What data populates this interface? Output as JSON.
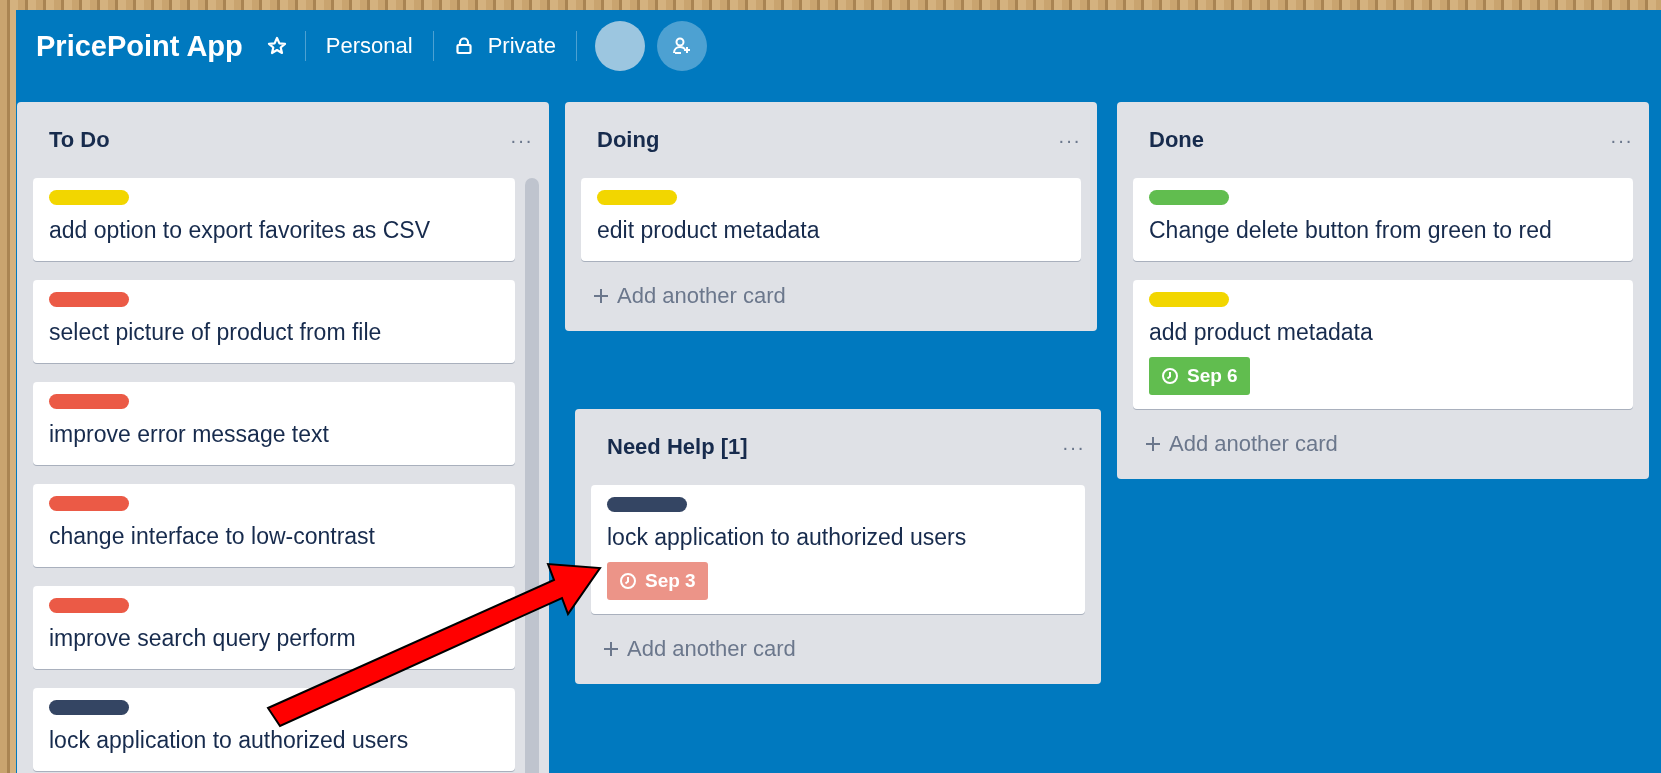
{
  "board": {
    "title": "PricePoint App",
    "starred": false,
    "team": "Personal",
    "visibility": "Private"
  },
  "lists": [
    {
      "title": "To Do",
      "menu": "···",
      "scrollable": true,
      "cards": [
        {
          "label": {
            "color": "#f2d600"
          },
          "text": "add option to export favorites as CSV"
        },
        {
          "label": {
            "color": "#eb5a46"
          },
          "text": "select picture of product from file"
        },
        {
          "label": {
            "color": "#eb5a46"
          },
          "text": "improve error message text"
        },
        {
          "label": {
            "color": "#eb5a46"
          },
          "text": "change interface to low-contrast"
        },
        {
          "label": {
            "color": "#eb5a46"
          },
          "text": "improve search query perform"
        },
        {
          "label": {
            "color": "#344563"
          },
          "text": "lock application to authorized users"
        }
      ]
    },
    {
      "title": "Doing",
      "menu": "···",
      "add": "Add another card",
      "cards": [
        {
          "label": {
            "color": "#f2d600"
          },
          "text": "edit product metadata"
        }
      ]
    },
    {
      "title": "Done",
      "menu": "···",
      "add": "Add another card",
      "cards": [
        {
          "label": {
            "color": "#61bd4f"
          },
          "text": "Change delete button from green to red"
        },
        {
          "label": {
            "color": "#f2d600"
          },
          "text": "add product metadata",
          "due": {
            "text": "Sep 6",
            "color": "#61bd4f"
          }
        }
      ]
    }
  ],
  "floating_list": {
    "title": "Need Help [1]",
    "menu": "···",
    "add": "Add another card",
    "cards": [
      {
        "label": {
          "color": "#344563"
        },
        "text": "lock application to authorized users",
        "due": {
          "text": "Sep 3",
          "color": "#ec9488"
        }
      }
    ]
  }
}
